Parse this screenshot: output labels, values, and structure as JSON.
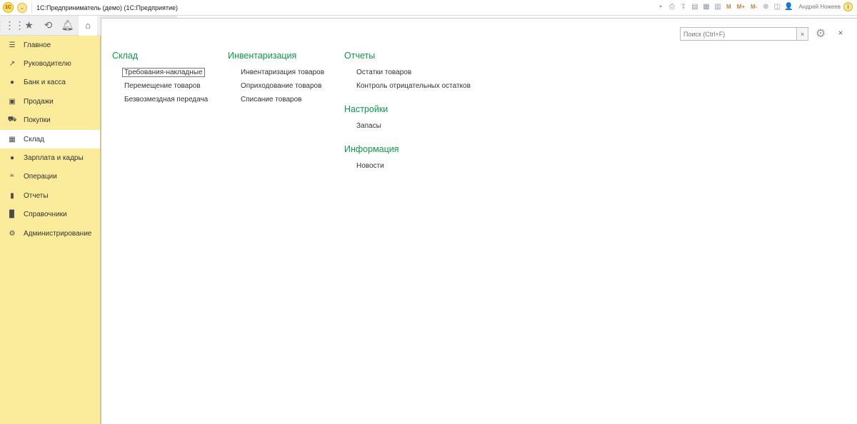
{
  "titlebar": {
    "logo_text": "1С",
    "title": "1С:Предприниматель (демо)  (1С:Предприятие)",
    "m_buttons": [
      "M",
      "M+",
      "M-"
    ],
    "user": "Андрей Ножеев",
    "info": "i"
  },
  "sidebar": {
    "items": [
      {
        "label": "Главное",
        "icon": "list-icon"
      },
      {
        "label": "Руководителю",
        "icon": "trend-icon"
      },
      {
        "label": "Банк и касса",
        "icon": "coin-icon"
      },
      {
        "label": "Продажи",
        "icon": "bag-icon"
      },
      {
        "label": "Покупки",
        "icon": "cart-icon"
      },
      {
        "label": "Склад",
        "icon": "grid-icon"
      },
      {
        "label": "Зарплата и кадры",
        "icon": "person-icon"
      },
      {
        "label": "Операции",
        "icon": "operations-icon"
      },
      {
        "label": "Отчеты",
        "icon": "barchart-icon"
      },
      {
        "label": "Справочники",
        "icon": "book-icon"
      },
      {
        "label": "Администрирование",
        "icon": "gear-icon"
      }
    ],
    "active_index": 5
  },
  "search": {
    "placeholder": "Поиск (Ctrl+F)",
    "clear": "×"
  },
  "close_label": "×",
  "sections": {
    "sklad": {
      "title": "Склад",
      "links": [
        "Требования-накладные",
        "Перемещение товаров",
        "Безвозмездная передача"
      ]
    },
    "inventory": {
      "title": "Инвентаризация",
      "links": [
        "Инвентаризация товаров",
        "Оприходование товаров",
        "Списание товаров"
      ]
    },
    "reports": {
      "title": "Отчеты",
      "links": [
        "Остатки товаров",
        "Контроль отрицательных остатков"
      ]
    },
    "settings": {
      "title": "Настройки",
      "links": [
        "Запасы"
      ]
    },
    "info": {
      "title": "Информация",
      "links": [
        "Новости"
      ]
    }
  }
}
